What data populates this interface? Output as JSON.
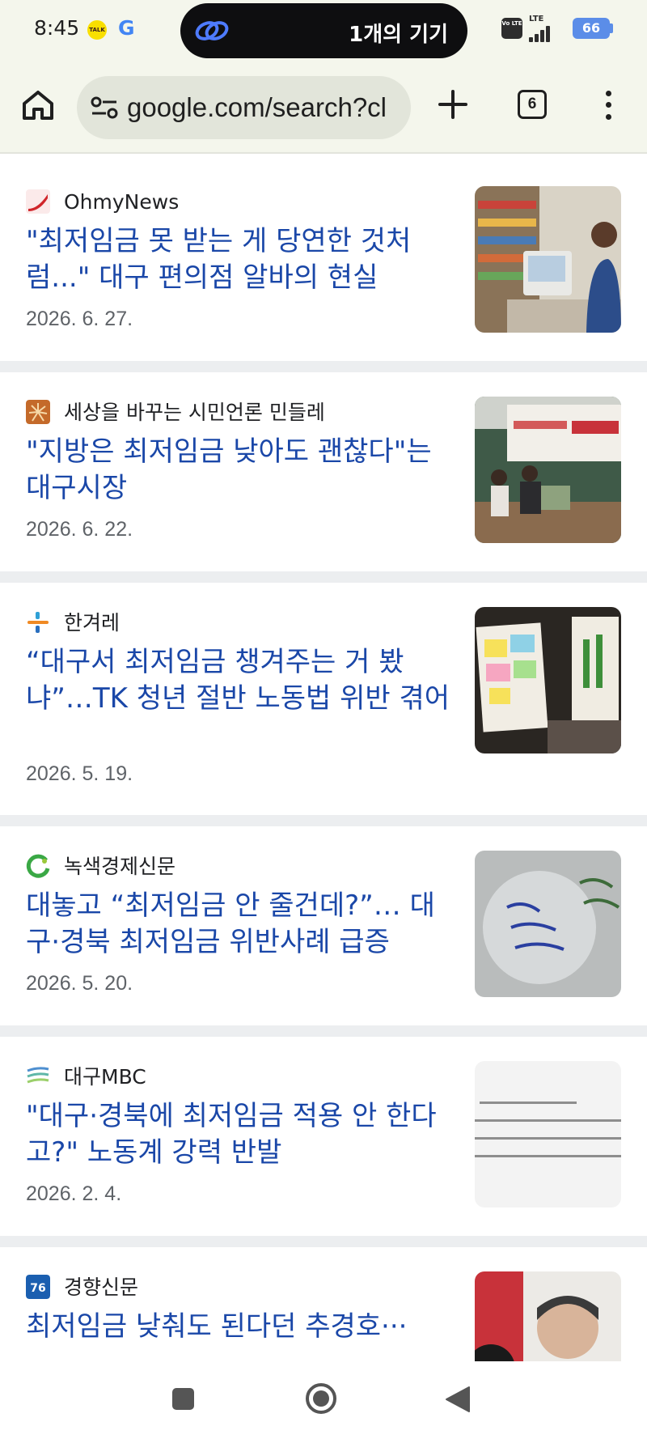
{
  "status_bar": {
    "time": "8:45",
    "kakao_label": "TALK",
    "google_letter": "G",
    "island_text": "1개의 기기",
    "volte": "Vo LTE",
    "lte": "LTE",
    "battery": "66"
  },
  "browser": {
    "url": "google.com/search?cl",
    "tab_count": "6"
  },
  "results": [
    {
      "source": "OhmyNews",
      "headline": "\"최저임금 못 받는 게 당연한 것처럼...\" 대구 편의점 알바의 현실",
      "date": "2026. 6. 27.",
      "favicon_color": "#d0262b",
      "thumb": "store-cashier-photo"
    },
    {
      "source": "세상을 바꾸는 시민언론 민들레",
      "headline": "\"지방은 최저임금 낮아도 괜찮다\"는 대구시장",
      "date": "2026. 6. 22.",
      "favicon_color": "#c46a2a",
      "thumb": "lecture-hall-photo"
    },
    {
      "source": "한겨레",
      "headline": "“대구서 최저임금 챙겨주는 거 봤냐”…TK 청년 절반 노동법 위반 겪어",
      "date": "2026. 5. 19.",
      "favicon_color": "#2a7fd4",
      "thumb": "sticky-notes-board-photo"
    },
    {
      "source": "녹색경제신문",
      "headline": "대놓고 “최저임금 안 줄건데?”… 대구·경북 최저임금 위반사례 급증",
      "date": "2026. 5. 20.",
      "favicon_color": "#3aa845",
      "thumb": "balloon-message-photo"
    },
    {
      "source": "대구MBC",
      "headline": "\"대구·경북에 최저임금 적용 안 한다고?\" 노동계 강력 반발",
      "date": "2026. 2. 4.",
      "favicon_color": "#5fb7a8",
      "thumb": "document-text-photo"
    },
    {
      "source": "경향신문",
      "headline": "최저임금 낮춰도 된다던 추경호···",
      "date": "",
      "favicon_color": "#1b5fb0",
      "thumb": "politician-photo"
    }
  ]
}
